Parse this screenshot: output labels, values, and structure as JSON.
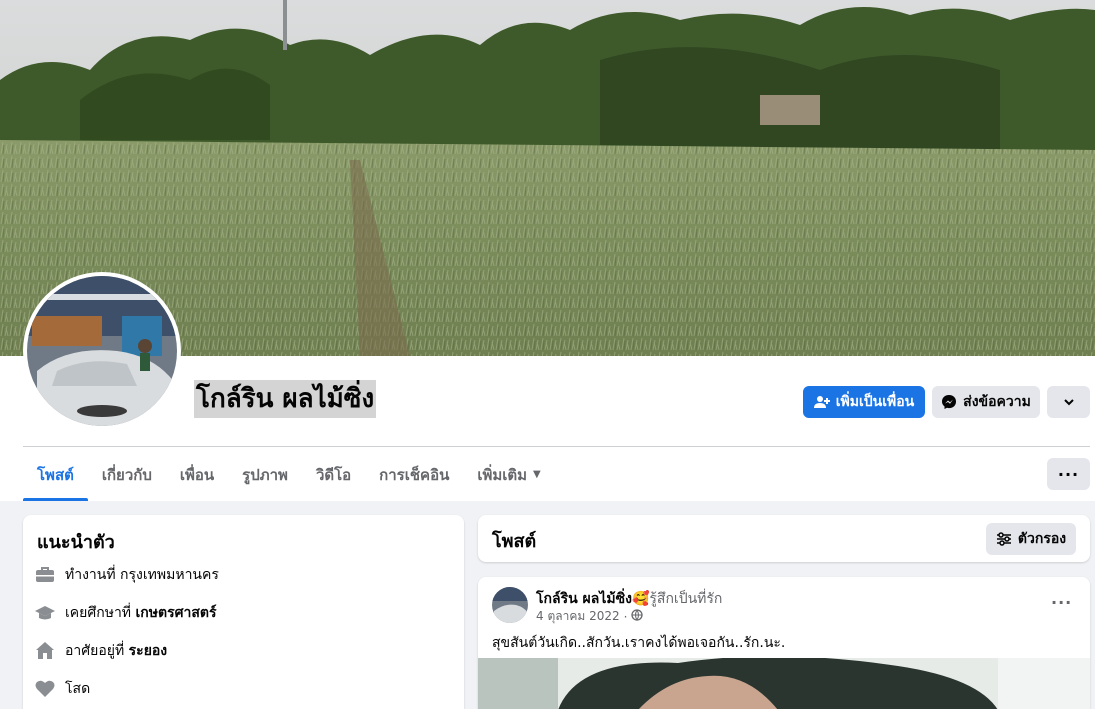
{
  "profile": {
    "name": "โกล์ริน ผลไม้ซิ่ง"
  },
  "actions": {
    "add_friend": "เพิ่มเป็นเพื่อน",
    "message": "ส่งข้อความ"
  },
  "tabs": [
    {
      "label": "โพสต์",
      "active": true
    },
    {
      "label": "เกี่ยวกับ"
    },
    {
      "label": "เพื่อน"
    },
    {
      "label": "รูปภาพ"
    },
    {
      "label": "วิดีโอ"
    },
    {
      "label": "การเช็คอิน"
    },
    {
      "label": "เพิ่มเติม"
    }
  ],
  "intro": {
    "title": "แนะนำตัว",
    "items": [
      {
        "icon": "briefcase-icon",
        "prefix": "ทำงานที่ กรุงเทพมหานคร",
        "bold": ""
      },
      {
        "icon": "graduation-cap-icon",
        "prefix": "เคยศึกษาที่ ",
        "bold": "เกษตรศาสตร์"
      },
      {
        "icon": "home-icon",
        "prefix": "อาศัยอยู่ที่ ",
        "bold": "ระยอง"
      },
      {
        "icon": "heart-icon",
        "prefix": "โสด",
        "bold": ""
      }
    ]
  },
  "posts": {
    "title": "โพสต์",
    "filter_label": "ตัวกรอง",
    "post": {
      "author": "โกล์ริน ผลไม้ซิ่ง",
      "feeling_emoji": "🥰",
      "feeling": "รู้สึกเป็นที่รัก",
      "date": "4 ตุลาคม 2022",
      "privacy": "·",
      "text": "สุขสันต์วันเกิด..สักวัน.เราคงได้พอเจอกัน..รัก.นะ."
    }
  },
  "colors": {
    "accent": "#1b74e4",
    "page_bg": "#f0f2f5",
    "secondary_text": "#65676b"
  }
}
